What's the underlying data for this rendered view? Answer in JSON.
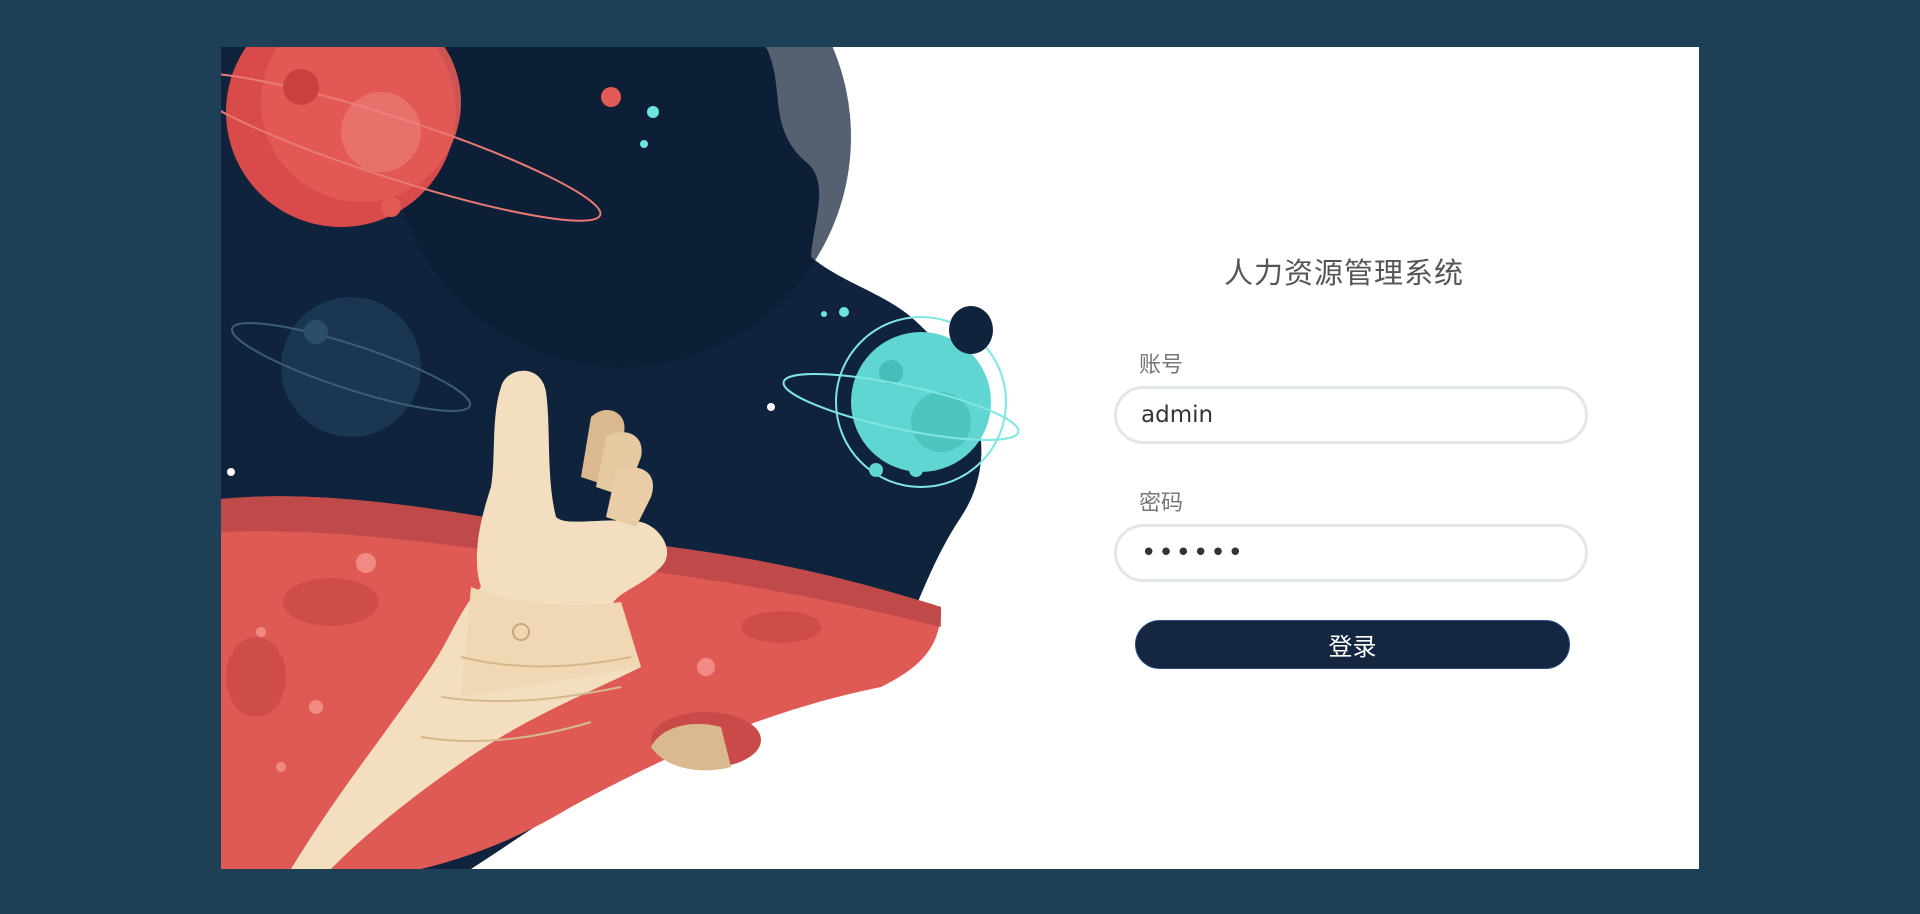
{
  "app": {
    "title": "人力资源管理系统"
  },
  "form": {
    "account_label": "账号",
    "account_value": "admin",
    "password_label": "密码",
    "password_value": "••••••",
    "login_button": "登录"
  },
  "colors": {
    "page_background": "#1d4057",
    "space_navy": "#102440",
    "planet_red": "#e05a55",
    "planet_teal": "#5fd6d1",
    "button_navy": "#142640"
  }
}
